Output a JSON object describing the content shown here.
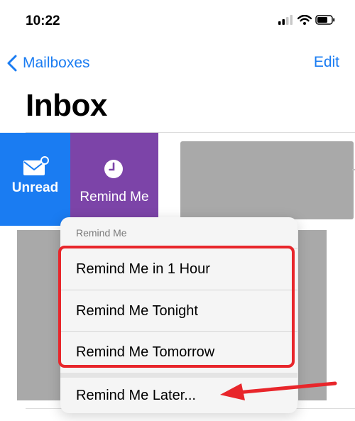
{
  "status_bar": {
    "time": "10:22",
    "icons": [
      "cellular-signal-icon",
      "wifi-icon",
      "battery-icon"
    ]
  },
  "nav": {
    "back_label": "Mailboxes",
    "edit_label": "Edit"
  },
  "page_title": "Inbox",
  "swipe_actions": {
    "unread_label": "Unread",
    "remind_label": "Remind Me"
  },
  "menu": {
    "header": "Remind Me",
    "items": [
      {
        "label": "Remind Me in 1 Hour"
      },
      {
        "label": "Remind Me Tonight"
      },
      {
        "label": "Remind Me Tomorrow"
      },
      {
        "label": "Remind Me Later..."
      }
    ]
  },
  "colors": {
    "accent_blue": "#1a7cf2",
    "remind_purple": "#7c44a8",
    "annotation_red": "#e8262b"
  }
}
